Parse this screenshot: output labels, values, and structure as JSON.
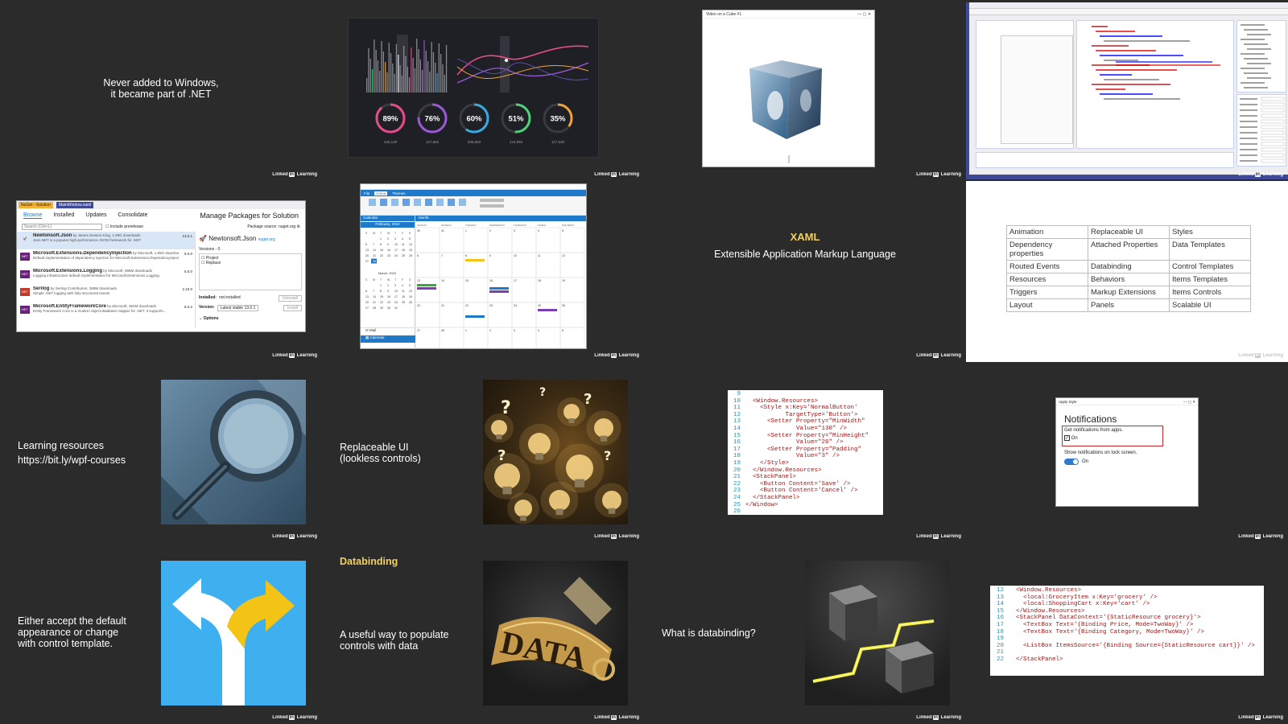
{
  "watermark": {
    "brand": "Linked",
    "in": "in",
    "suffix": "Learning"
  },
  "tiles": {
    "t1": {
      "line1": "Never added to Windows,",
      "line2": "it became part of .NET"
    },
    "t2": {
      "gauges": [
        {
          "label": "89%",
          "value": 89,
          "color": "#e64c8c",
          "sub": "245,128"
        },
        {
          "label": "76%",
          "value": 76,
          "color": "#9b59d6",
          "sub": "137,682"
        },
        {
          "label": "60%",
          "value": 60,
          "color": "#3aa9e0",
          "sub": "538,693"
        },
        {
          "label": "51%",
          "value": 51,
          "color": "#4ed17a",
          "sub": "124,993"
        },
        {
          "label": "35%",
          "value": 35,
          "color": "#f0a13a",
          "sub": "117,528"
        }
      ]
    },
    "t3": {
      "window_title": "Video on a Cube #1"
    },
    "t4": {},
    "t5": {
      "tab_title": "NuGet - Solution",
      "file_tab": "MainWindow.xaml",
      "tabs": [
        "Browse",
        "Installed",
        "Updates",
        "Consolidate"
      ],
      "header": "Manage Packages for Solution",
      "search_placeholder": "Search (Ctrl+L)",
      "prerelease": "Include prerelease",
      "source_label": "Package source:",
      "source_value": "nuget.org",
      "packages": [
        {
          "name": "Newtonsoft.Json",
          "by": "by James Newton-King, 1.69G downloads",
          "desc": "Json.NET is a popular high-performance JSON framework for .NET",
          "ver": "13.0.1"
        },
        {
          "name": "Microsoft.Extensions.DependencyInjection",
          "by": "by Microsoft, 1.85G downloads",
          "desc": "Default implementation of dependency injection for Microsoft.Extensions.DependencyInjection.",
          "ver": "6.0.0"
        },
        {
          "name": "Microsoft.Extensions.Logging",
          "by": "by Microsoft, 985M downloads",
          "desc": "Logging infrastructure default implementation for Microsoft.Extensions.Logging.",
          "ver": "6.0.0"
        },
        {
          "name": "Serilog",
          "by": "by Serilog Contributors, 388M downloads",
          "desc": "Simple .NET logging with fully-structured events",
          "ver": "2.10.0"
        },
        {
          "name": "Microsoft.EntityFrameworkCore",
          "by": "by Microsoft, 361M downloads",
          "desc": "Entity Framework Core is a modern object-database mapper for .NET. It supports...",
          "ver": "6.0.2"
        }
      ],
      "detail_title": "Newtonsoft.Json",
      "detail_source": "nuget.org",
      "versions_label": "Versions - 0",
      "checks": [
        "Project",
        "Replace"
      ],
      "installed_label": "Installed:",
      "installed_value": "not installed",
      "uninstall": "Uninstall",
      "version_label": "Version:",
      "version_value": "Latest stable 13.0.1",
      "install": "Install",
      "options": "Options"
    },
    "t6": {
      "ribbon_tabs": [
        "File",
        "Home",
        "Themes"
      ],
      "calendar_title": "Calendar",
      "month": "February, 2022",
      "month2": "March, 2022",
      "view_label": "Month",
      "days": [
        "SUNDAY",
        "MONDAY",
        "TUESDAY",
        "WEDNESDAY",
        "THURSDAY",
        "FRIDAY",
        "SATURDAY"
      ],
      "mini_days": [
        "S",
        "M",
        "T",
        "W",
        "T",
        "F",
        "S"
      ],
      "side_items": [
        "Mail",
        "Calendar"
      ]
    },
    "t7": {
      "title": "XAML",
      "subtitle": "Extensible Application Markup Language"
    },
    "t8": {
      "rows": [
        [
          "Animation",
          "Replaceable UI",
          "Styles"
        ],
        [
          "Dependency properties",
          "Attached Properties",
          "Data Templates"
        ],
        [
          "Routed Events",
          "Databinding",
          "Control Templates"
        ],
        [
          "Resources",
          "Behaviors",
          "Items Templates"
        ],
        [
          "Triggers",
          "Markup Extensions",
          "Items Controls"
        ],
        [
          "Layout",
          "Panels",
          "Scalable UI"
        ]
      ]
    },
    "t9": {
      "line1": "Learning resources",
      "line2": "https://bit.ly/wpf-courses"
    },
    "t10": {
      "line1": "Replaceable UI",
      "line2": "(lookless controls)"
    },
    "t11": {
      "lines": [
        {
          "n": "9",
          "t": ""
        },
        {
          "n": "10",
          "t": "  <Window.Resources>"
        },
        {
          "n": "11",
          "t": "    <Style x:Key='NormalButton'"
        },
        {
          "n": "12",
          "t": "           TargetType='Button'>"
        },
        {
          "n": "13",
          "t": "      <Setter Property=\"MinWidth\""
        },
        {
          "n": "14",
          "t": "              Value=\"130\" />"
        },
        {
          "n": "15",
          "t": "      <Setter Property=\"MinHeight\""
        },
        {
          "n": "16",
          "t": "              Value=\"26\" />"
        },
        {
          "n": "17",
          "t": "      <Setter Property=\"Padding\""
        },
        {
          "n": "18",
          "t": "              Value=\"3\" />"
        },
        {
          "n": "19",
          "t": "    </Style>"
        },
        {
          "n": "20",
          "t": "  </Window.Resources>"
        },
        {
          "n": "21",
          "t": "  <StackPanel>"
        },
        {
          "n": "22",
          "t": "    <Button Content='Save' />"
        },
        {
          "n": "23",
          "t": "    <Button Content='Cancel' />"
        },
        {
          "n": "24",
          "t": "  </StackPanel>"
        },
        {
          "n": "25",
          "t": "</Window>"
        },
        {
          "n": "26",
          "t": ""
        }
      ]
    },
    "t12": {
      "window_title": "Apply Style",
      "heading": "Notifications",
      "option1": "Get notifications from apps.",
      "check_label": "On",
      "option2": "Show notifications on lock screen.",
      "toggle_label": "On"
    },
    "t13": {
      "line1": "Either accept the default",
      "line2": "appearance or change",
      "line3": "with control template."
    },
    "t14": {
      "title": "Databinding",
      "line1": "A useful way to populate",
      "line2": "controls with data",
      "tag_text": "DATA"
    },
    "t15": {
      "line1": "What is databinding?"
    },
    "t16": {
      "lines": [
        {
          "n": "12",
          "t": "  <Window.Resources>"
        },
        {
          "n": "13",
          "t": "    <local:GroceryItem x:Key='grocery' />"
        },
        {
          "n": "14",
          "t": "    <local:ShoppingCart x:Key='cart' />"
        },
        {
          "n": "15",
          "t": "  </Window.Resources>"
        },
        {
          "n": "16",
          "t": "  <StackPanel DataContext='{StaticResource grocery}'>"
        },
        {
          "n": "17",
          "t": "    <TextBox Text='{Binding Price, Mode=TwoWay}' />"
        },
        {
          "n": "18",
          "t": "    <TextBox Text='{Binding Category, Mode=TwoWay}' />"
        },
        {
          "n": "19",
          "t": ""
        },
        {
          "n": "20",
          "t": "    <ListBox ItemsSource='{Binding Source={StaticResource cart}}' />"
        },
        {
          "n": "21",
          "t": ""
        },
        {
          "n": "22",
          "t": "  </StackPanel>"
        }
      ]
    }
  },
  "colors": {
    "background": "#2b2b2b",
    "accent_yellow": "#f3d15e",
    "vs_blue": "#3e4a97",
    "nuget_purple": "#68217a",
    "calendar_blue": "#1e79c8",
    "sky_blue": "#3fb0ef"
  }
}
